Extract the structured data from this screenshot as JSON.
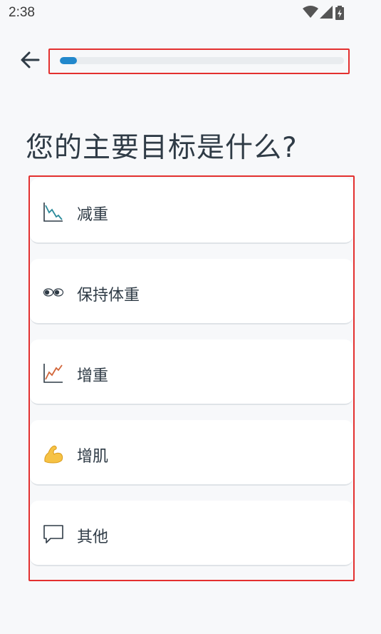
{
  "status_bar": {
    "time": "2:38",
    "icons": [
      "wifi-icon",
      "cell-signal-icon",
      "battery-charging-icon"
    ]
  },
  "header": {
    "back_icon": "arrow-left-icon",
    "progress_fraction": 0.06,
    "progress_color": "#2288cc"
  },
  "question": {
    "title": "您的主要目标是什么?"
  },
  "options": [
    {
      "label": "减重",
      "icon": "chart-down-icon"
    },
    {
      "label": "保持体重",
      "icon": "eyes-icon"
    },
    {
      "label": "增重",
      "icon": "chart-up-icon"
    },
    {
      "label": "增肌",
      "icon": "flexed-biceps-icon"
    },
    {
      "label": "其他",
      "icon": "speech-bubble-icon"
    }
  ],
  "colors": {
    "accent": "#2288cc",
    "highlight_border": "#e3302f",
    "background": "#f7f8fa"
  }
}
